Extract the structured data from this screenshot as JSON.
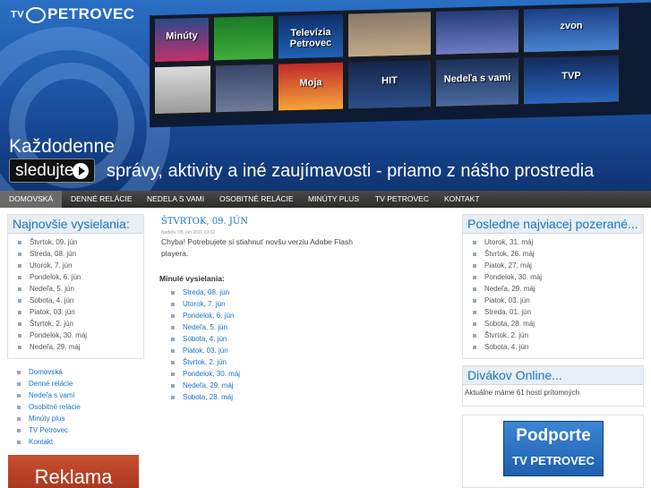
{
  "header": {
    "logo_tv": "TV",
    "logo_name": "PETROVEC",
    "tiles": [
      "Minúty",
      "Televízia Petrovec",
      "zvon",
      "Moja",
      "HIT",
      "Nedeľa s vami",
      "TVP"
    ],
    "tagline_prefix": "Každodenne",
    "watch_button": "sledujte",
    "tagline": "správy, aktivity a iné zaujímavosti - priamo z nášho prostredia"
  },
  "nav": {
    "items": [
      "DOMOVSKÁ",
      "DENNÉ RELÁCIE",
      "NEDELA S VAMI",
      "OSOBITNÉ RELÁCIE",
      "MINÚTY PLUS",
      "TV PETROVEC",
      "KONTAKT"
    ]
  },
  "left": {
    "latest_title": "Najnovšie vysielania:",
    "latest": [
      "Štvrtok, 09. jún",
      "Streda, 08. jún",
      "Utorok, 7. jún",
      "Pondelok, 6. jún",
      "Nedeľa, 5. jún",
      "Sobota, 4. jún",
      "Piatok, 03. jún",
      "Štvrtok, 2. jún",
      "Pondelok, 30. máj",
      "Nedeľa, 29. máj"
    ],
    "menu": [
      "Domovská",
      "Denné relácie",
      "Nedeľa s vami",
      "Osobitné relácie",
      "Minúty plus",
      "TV Petrovec",
      "Kontakt"
    ],
    "ad_label": "Reklama"
  },
  "main": {
    "title": "ŠTVRTOK, 09. JÚN",
    "meta": "Nedeľa, 05. jún 2011 19:02",
    "message": "Chyba! Potrebujete si stiahnuť novšu verziu Adobe Flash playera.",
    "past_heading": "Minulé vysielania:",
    "past": [
      "Streda, 08. jún",
      "Utorok, 7. jún",
      "Pondelok, 6. jún",
      "Nedeľa, 5. jún",
      "Sobota, 4. jún",
      "Piatok, 03. jún",
      "Štvrtok, 2. jún",
      "Pondelok, 30. máj",
      "Nedeľa, 29. máj",
      "Sobota, 28. máj"
    ]
  },
  "right": {
    "popular_title": "Posledne najviacej pozerané...",
    "popular": [
      "Utorok, 31. máj",
      "Štvrtok, 26. máj",
      "Piatok, 27. máj",
      "Pondelok, 30. máj",
      "Nedeľa, 29. máj",
      "Piatok, 03. jún",
      "Streda, 01. jún",
      "Sobota, 28. máj",
      "Štvrtok, 2. jún",
      "Sobota, 4. jún"
    ],
    "online_title": "Divákov Online...",
    "online_text": "Aktuálne máme 61 hostí prítomných",
    "support_line1": "Podporte",
    "support_line2": "TV PETROVEC"
  }
}
